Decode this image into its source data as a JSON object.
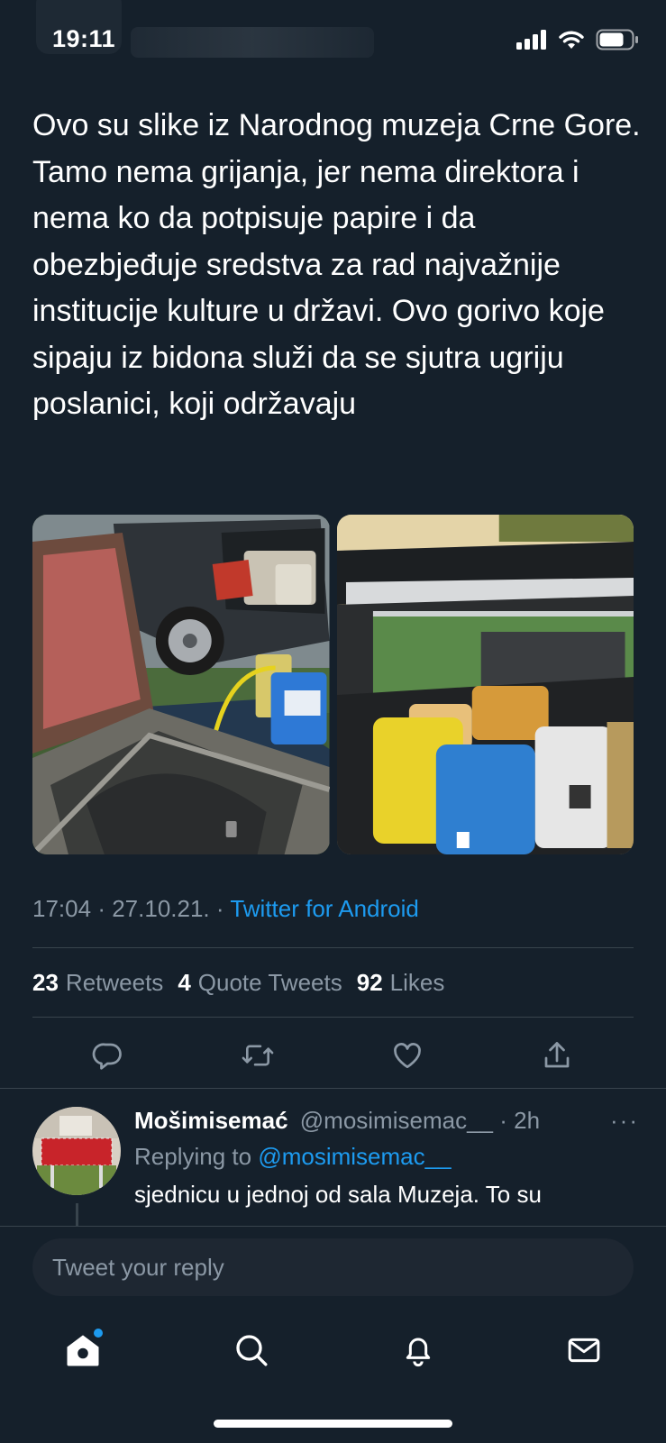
{
  "status_bar": {
    "time": "19:11"
  },
  "tweet": {
    "text": "Ovo su slike iz Narodnog muzeja Crne Gore. Tamo nema grijanja, jer nema direktora i nema ko da potpisuje papire i da obezbjeđuje sredstva za rad najvažnije institucije kulture u državi. Ovo gorivo koje sipaju iz bidona služi da se sjutra ugriju poslanici, koji održavaju",
    "time": "17:04",
    "date": "27.10.21.",
    "separator": "·",
    "source": "Twitter for Android"
  },
  "stats": {
    "retweets": {
      "count": "23",
      "label": "Retweets"
    },
    "quotes": {
      "count": "4",
      "label": "Quote Tweets"
    },
    "likes": {
      "count": "92",
      "label": "Likes"
    }
  },
  "actions": [
    "reply-icon",
    "retweet-icon",
    "like-icon",
    "share-icon"
  ],
  "reply": {
    "name": "Mošimisemać",
    "handle": "@mosimisemac__",
    "age": "· 2h",
    "more": "···",
    "replying_prefix": "Replying to",
    "replying_to": "@mosimisemac__",
    "text": "sjednicu u jednoj od sala Muzeja. To su"
  },
  "composer": {
    "placeholder": "Tweet your reply"
  },
  "nav": [
    "home-icon",
    "search-icon",
    "notifications-icon",
    "messages-icon"
  ],
  "colors": {
    "background": "#15202b",
    "accent": "#1d9bf0",
    "muted": "#8b98a5",
    "divider": "#38444d"
  }
}
